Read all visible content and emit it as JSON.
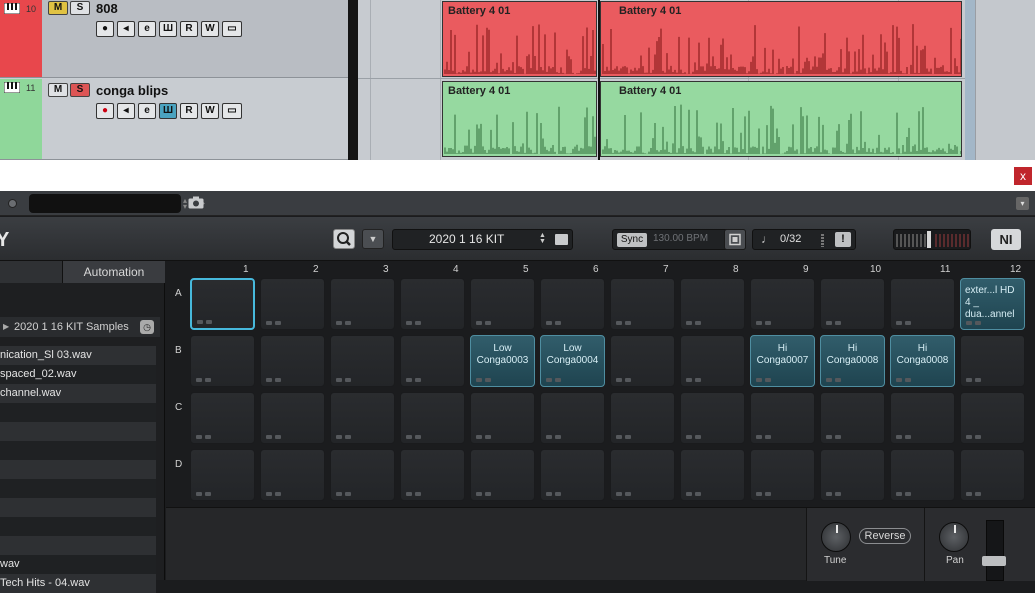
{
  "daw": {
    "tracks": [
      {
        "number": "10",
        "name": "808",
        "color": "#e8474c",
        "mute": "M",
        "solo": "S",
        "controls": [
          "●",
          "◂",
          "e",
          "Ш",
          "R",
          "W",
          "▭"
        ]
      },
      {
        "number": "11",
        "name": "conga blips",
        "color": "#8fd79a",
        "mute": "M",
        "solo": "S",
        "controls": [
          "●",
          "◂",
          "e",
          "Ш",
          "R",
          "W",
          "▭"
        ]
      }
    ],
    "clips": [
      {
        "label": "Battery 4 01",
        "lane": "red"
      },
      {
        "label": "Battery 4 01",
        "lane": "red"
      },
      {
        "label": "Battery 4 01",
        "lane": "green"
      },
      {
        "label": "Battery 4 01",
        "lane": "green"
      }
    ]
  },
  "window": {
    "close_label": "x"
  },
  "host": {
    "preset_tag": "◇",
    "menu_label": "▾"
  },
  "battery": {
    "logo_fragment": "Y",
    "search_icon": "search-icon",
    "kit_name": "2020 1 16 KIT",
    "sync_label": "Sync",
    "bpm": "130.00 BPM",
    "voices": "0/32",
    "alert": "!",
    "ni_logo": "NI",
    "volume_level": 0.45
  },
  "left_panel": {
    "tab_automation": "Automation",
    "path": "2020 1 16 KIT Samples",
    "files": [
      "nication_Sl 03.wav",
      "spaced_02.wav",
      "channel.wav",
      "",
      "",
      "",
      "",
      "",
      "",
      "",
      "",
      "wav",
      "Tech Hits - 04.wav"
    ]
  },
  "pad_grid": {
    "columns": [
      "1",
      "2",
      "3",
      "4",
      "5",
      "6",
      "7",
      "8",
      "9",
      "10",
      "11",
      "12"
    ],
    "rows": [
      "A",
      "B",
      "C",
      "D"
    ],
    "cells": {
      "A12": "exter...l HD 4 _ dua...annel",
      "B5": "Low Conga0003",
      "B6": "Low Conga0004",
      "B9": "Hi Conga0007",
      "B10": "Hi Conga0008",
      "B11": "Hi Conga0008"
    },
    "selected": "A1"
  },
  "cell_panel": {
    "tune_label": "Tune",
    "reverse_label": "Reverse",
    "pan_label": "Pan"
  }
}
